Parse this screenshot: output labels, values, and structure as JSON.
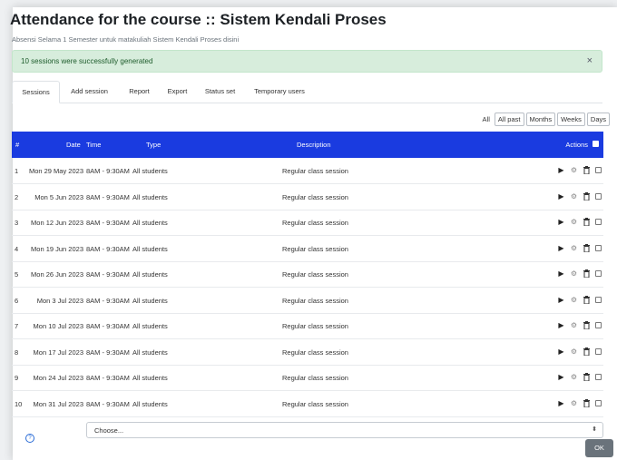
{
  "page": {
    "title": "Attendance for the course :: Sistem Kendali Proses",
    "subtitle": "Absensi Selama 1 Semester untuk matakuliah Sistem Kendali Proses disini"
  },
  "alert": {
    "text": "10 sessions were successfully generated",
    "close": "×"
  },
  "tabs": [
    {
      "label": "Sessions",
      "active": true
    },
    {
      "label": "Add session"
    },
    {
      "label": "Report"
    },
    {
      "label": "Export"
    },
    {
      "label": "Status set"
    },
    {
      "label": "Temporary users"
    }
  ],
  "filters": {
    "all": "All",
    "all_past": "All past",
    "months": "Months",
    "weeks": "Weeks",
    "days": "Days"
  },
  "table": {
    "headers": {
      "num": "#",
      "date": "Date",
      "time": "Time",
      "type": "Type",
      "description": "Description",
      "actions": "Actions"
    },
    "rows": [
      {
        "num": "1",
        "date": "Mon 29 May 2023",
        "time": "8AM - 9:30AM",
        "type": "All students",
        "description": "Regular class session"
      },
      {
        "num": "2",
        "date": "Mon 5 Jun 2023",
        "time": "8AM - 9:30AM",
        "type": "All students",
        "description": "Regular class session"
      },
      {
        "num": "3",
        "date": "Mon 12 Jun 2023",
        "time": "8AM - 9:30AM",
        "type": "All students",
        "description": "Regular class session"
      },
      {
        "num": "4",
        "date": "Mon 19 Jun 2023",
        "time": "8AM - 9:30AM",
        "type": "All students",
        "description": "Regular class session"
      },
      {
        "num": "5",
        "date": "Mon 26 Jun 2023",
        "time": "8AM - 9:30AM",
        "type": "All students",
        "description": "Regular class session"
      },
      {
        "num": "6",
        "date": "Mon 3 Jul 2023",
        "time": "8AM - 9:30AM",
        "type": "All students",
        "description": "Regular class session"
      },
      {
        "num": "7",
        "date": "Mon 10 Jul 2023",
        "time": "8AM - 9:30AM",
        "type": "All students",
        "description": "Regular class session"
      },
      {
        "num": "8",
        "date": "Mon 17 Jul 2023",
        "time": "8AM - 9:30AM",
        "type": "All students",
        "description": "Regular class session"
      },
      {
        "num": "9",
        "date": "Mon 24 Jul 2023",
        "time": "8AM - 9:30AM",
        "type": "All students",
        "description": "Regular class session"
      },
      {
        "num": "10",
        "date": "Mon 31 Jul 2023",
        "time": "8AM - 9:30AM",
        "type": "All students",
        "description": "Regular class session"
      }
    ],
    "row_action_icons": [
      "play-icon",
      "gear-icon",
      "trash-icon",
      "checkbox"
    ]
  },
  "bulk_action": {
    "select_value": "Choose...",
    "ok_label": "OK"
  },
  "colors": {
    "table_header": "#1a3be0",
    "alert_background": "#d7eddc",
    "ok_button": "#6a737b"
  }
}
